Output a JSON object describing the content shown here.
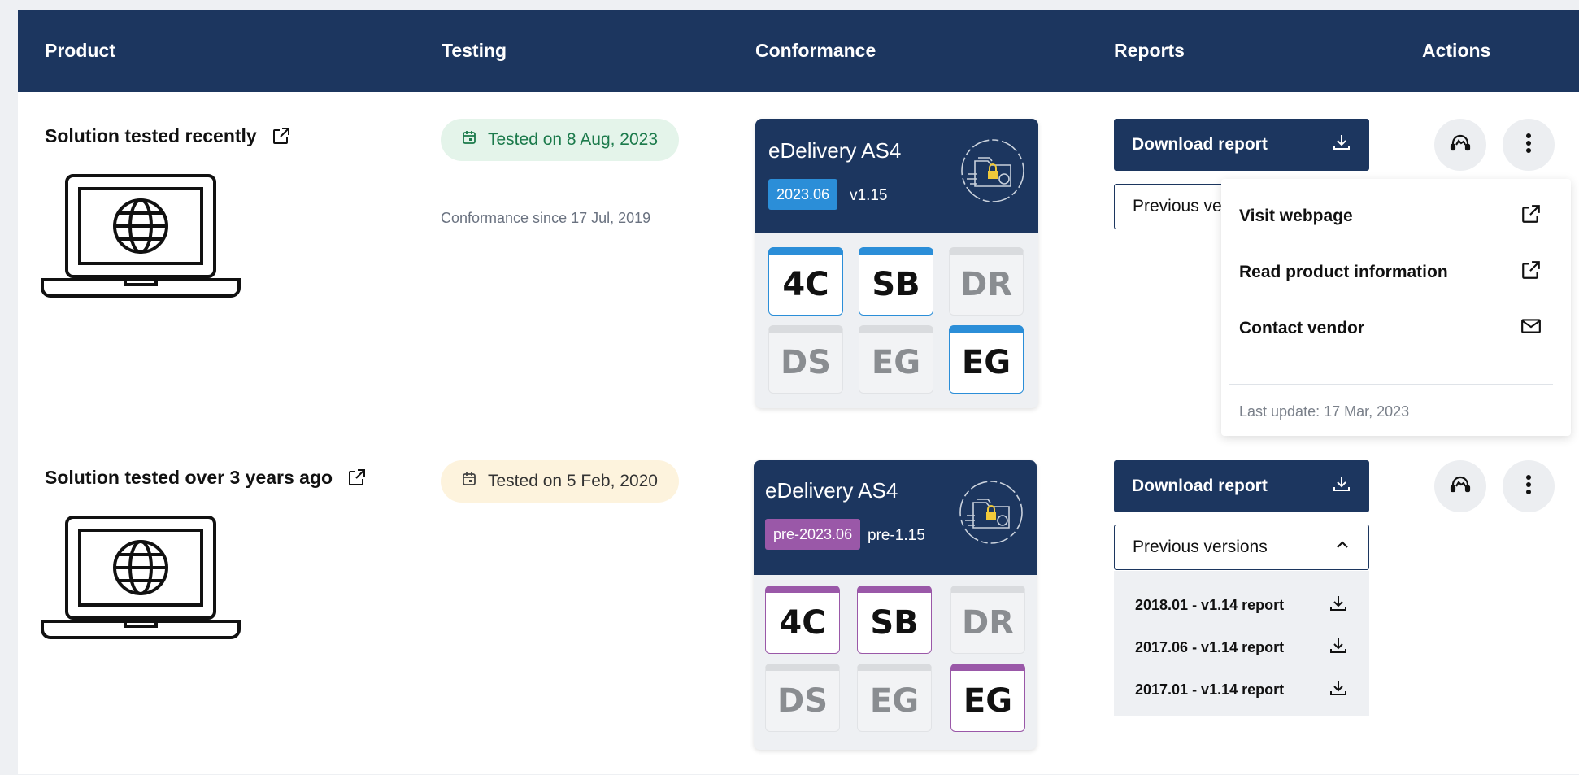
{
  "header": {
    "product": "Product",
    "testing": "Testing",
    "conformance": "Conformance",
    "reports": "Reports",
    "actions": "Actions"
  },
  "rows": [
    {
      "title": "Solution tested recently",
      "tested": "Tested on 8 Aug, 2023",
      "since": "Conformance since 17 Jul, 2019",
      "conformance": {
        "title": "eDelivery AS4",
        "badge": "2023.06",
        "version": "v1.15",
        "tiles": [
          "4C",
          "SB",
          "DR",
          "DS",
          "EG",
          "EG"
        ],
        "accent": "#2b8ed8"
      },
      "download_label": "Download report",
      "previous_label": "Previous versions"
    },
    {
      "title": "Solution tested over 3 years ago",
      "tested": "Tested on 5 Feb, 2020",
      "conformance": {
        "title": "eDelivery AS4",
        "badge": "pre-2023.06",
        "version": "pre-1.15",
        "tiles": [
          "4C",
          "SB",
          "DR",
          "DS",
          "EG",
          "EG"
        ],
        "accent": "#9a58a8"
      },
      "download_label": "Download report",
      "previous_label": "Previous versions",
      "previous_items": [
        "2018.01 - v1.14 report",
        "2017.06 - v1.14 report",
        "2017.01 - v1.14 report"
      ]
    }
  ],
  "menu": {
    "items": [
      "Visit webpage",
      "Read product information",
      "Contact vendor"
    ],
    "footer": "Last update: 17 Mar, 2023"
  },
  "colors": {
    "header_bg": "#1c365f",
    "tested_recent_bg": "#e4f4ea",
    "tested_recent_text": "#1b7a4b",
    "tested_old_bg": "#fdf3dd",
    "badge_blue": "#2b8ed8",
    "badge_purple": "#9a58a8"
  }
}
